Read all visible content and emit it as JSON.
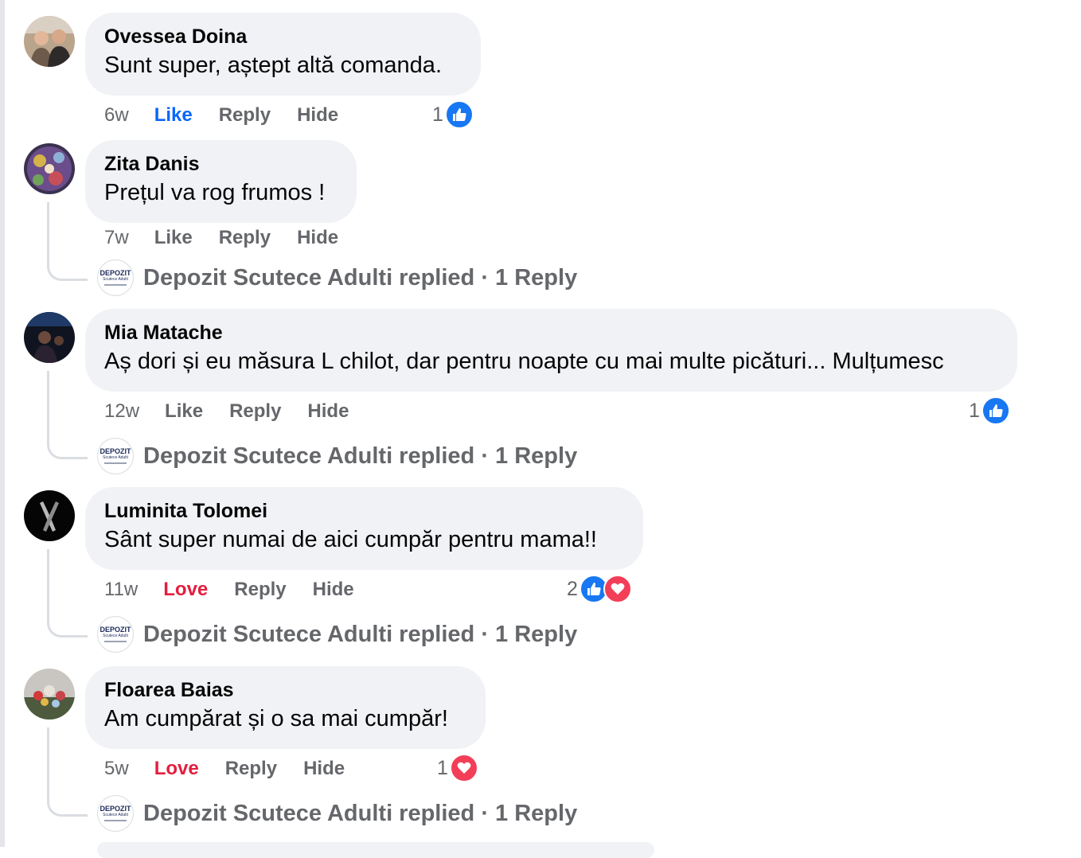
{
  "comments": [
    {
      "author": "Ovessea Doina",
      "text": "Sunt super, aștept altă comanda.",
      "time": "6w",
      "reaction_label": "Like",
      "reply_label": "Reply",
      "hide_label": "Hide",
      "reaction_count": "1",
      "reaction_types": [
        "like"
      ]
    },
    {
      "author": "Zita Danis",
      "text": "Prețul va rog frumos !",
      "time": "7w",
      "reaction_label": "Like",
      "reply_label": "Reply",
      "hide_label": "Hide",
      "replied_text": "Depozit Scutece Adulti replied · 1 Reply"
    },
    {
      "author": "Mia Matache",
      "text": "Aș dori și eu măsura L chilot, dar pentru noapte cu mai multe picături... Mulțumesc",
      "time": "12w",
      "reaction_label": "Like",
      "reply_label": "Reply",
      "hide_label": "Hide",
      "reaction_count": "1",
      "reaction_types": [
        "like"
      ],
      "replied_text": "Depozit Scutece Adulti replied · 1 Reply"
    },
    {
      "author": "Luminita Tolomei",
      "text": "Sânt super numai de aici cumpăr pentru mama!!",
      "time": "11w",
      "reaction_label": "Love",
      "reply_label": "Reply",
      "hide_label": "Hide",
      "reaction_count": "2",
      "reaction_types": [
        "like",
        "love"
      ],
      "replied_text": "Depozit Scutece Adulti replied · 1 Reply"
    },
    {
      "author": "Floarea Baias",
      "text": "Am cumpărat și o sa mai cumpăr!",
      "time": "5w",
      "reaction_label": "Love",
      "reply_label": "Reply",
      "hide_label": "Hide",
      "reaction_count": "1",
      "reaction_types": [
        "love"
      ],
      "replied_text": "Depozit Scutece Adulti replied · 1 Reply"
    }
  ],
  "page_avatar": {
    "line1": "DEPOZIT",
    "line2": "Scutece Adulti"
  },
  "colors": {
    "bubble": "#f0f2f5",
    "meta_text": "#65676b",
    "like_blue": "#0866ff",
    "love_red": "#e41e3f"
  }
}
